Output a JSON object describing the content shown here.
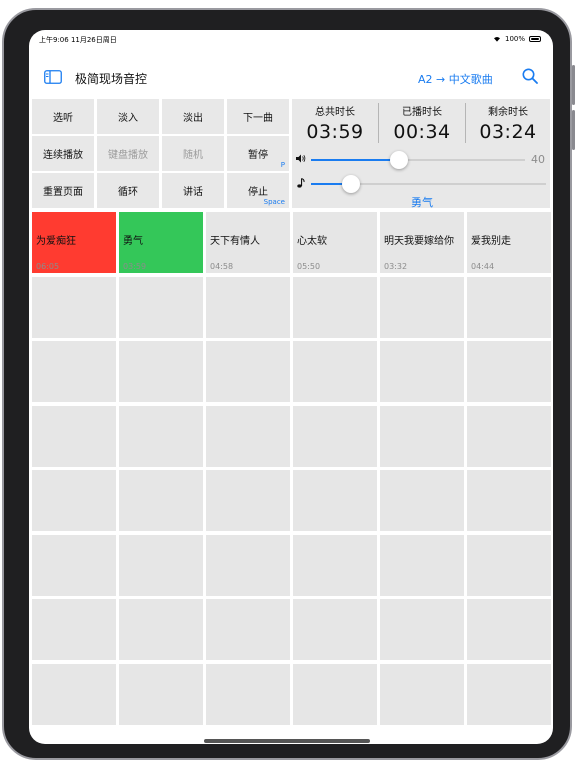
{
  "status_bar": {
    "time": "上午9:06  11月26日周日",
    "battery": "100%"
  },
  "header": {
    "title": "极简现场音控",
    "route": "A2 → 中文歌曲"
  },
  "controls": [
    {
      "label": "选听",
      "shortcut": "",
      "disabled": false
    },
    {
      "label": "淡入",
      "shortcut": "",
      "disabled": false
    },
    {
      "label": "淡出",
      "shortcut": "",
      "disabled": false
    },
    {
      "label": "下一曲",
      "shortcut": "",
      "disabled": false
    },
    {
      "label": "连续播放",
      "shortcut": "",
      "disabled": false
    },
    {
      "label": "键盘播放",
      "shortcut": "",
      "disabled": true
    },
    {
      "label": "随机",
      "shortcut": "",
      "disabled": true
    },
    {
      "label": "暂停",
      "shortcut": "P",
      "disabled": false
    },
    {
      "label": "重置页面",
      "shortcut": "",
      "disabled": false
    },
    {
      "label": "循环",
      "shortcut": "",
      "disabled": false
    },
    {
      "label": "讲话",
      "shortcut": "",
      "disabled": false
    },
    {
      "label": "停止",
      "shortcut": "Space",
      "disabled": false
    }
  ],
  "times": {
    "total": {
      "label": "总共时长",
      "value": "03:59"
    },
    "played": {
      "label": "已播时长",
      "value": "00:34"
    },
    "remaining": {
      "label": "剩余时长",
      "value": "03:24"
    }
  },
  "volume": {
    "value": "40",
    "level": 0.41
  },
  "progress": {
    "level": 0.17
  },
  "now_playing": "勇气",
  "songs": [
    {
      "title": "为爱痴狂",
      "duration": "06:05",
      "state": "red"
    },
    {
      "title": "勇气",
      "duration": "03:59",
      "state": "green"
    },
    {
      "title": "天下有情人",
      "duration": "04:58",
      "state": ""
    },
    {
      "title": "心太软",
      "duration": "05:50",
      "state": ""
    },
    {
      "title": "明天我要嫁给你",
      "duration": "03:32",
      "state": ""
    },
    {
      "title": "爱我别走",
      "duration": "04:44",
      "state": ""
    }
  ],
  "colors": {
    "accent": "#1a7cf0",
    "red": "#ff3b30",
    "green": "#34c759",
    "cell": "#e6e6e6"
  }
}
